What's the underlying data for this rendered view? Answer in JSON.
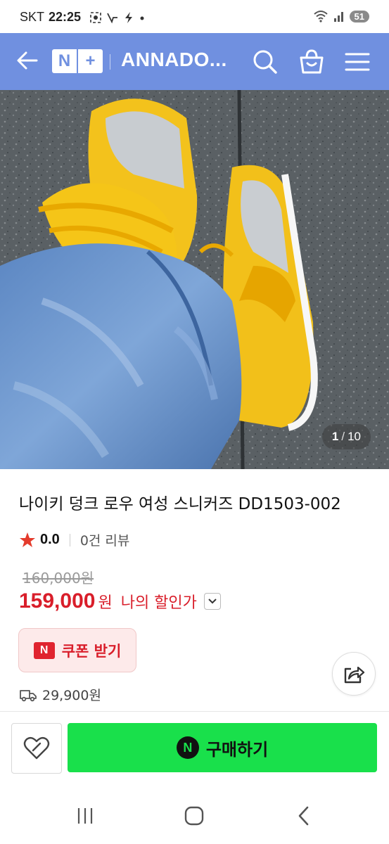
{
  "status_bar": {
    "carrier": "SKT",
    "time": "22:25",
    "battery": "51"
  },
  "header": {
    "logo_left": "N",
    "logo_right": "+",
    "store_name": "ANNADO..."
  },
  "gallery": {
    "current": "1",
    "separator": "/",
    "total": "10"
  },
  "product": {
    "title": "나이키 덩크 로우 여성 스니커즈 DD1503-002",
    "rating": "0.0",
    "reviews": "0건 리뷰",
    "original_price": "160,000원",
    "price": "159,000",
    "currency": "원",
    "discount_label": "나의 할인가",
    "coupon_badge": "N",
    "coupon_label": "쿠폰 받기",
    "shipping_fee": "29,900원"
  },
  "bottom_bar": {
    "pay_badge": "N",
    "buy_label": "구매하기"
  },
  "colors": {
    "header_bg": "#7090e0",
    "price_red": "#d91e2a",
    "buy_green": "#19e04b"
  }
}
